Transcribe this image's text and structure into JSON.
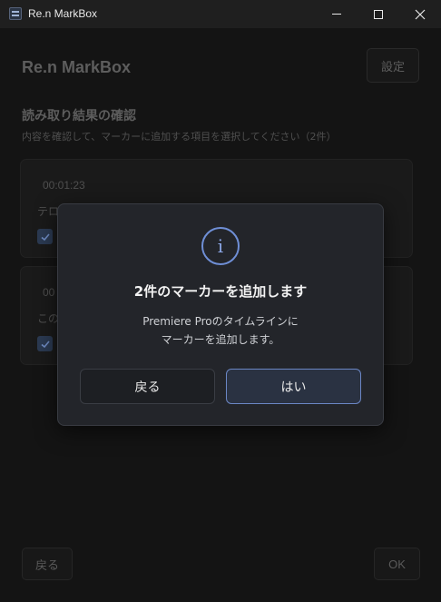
{
  "window": {
    "title": "Re.n MarkBox",
    "minimize": "—",
    "maximize": "☐",
    "close": "✕"
  },
  "app": {
    "title": "Re.n MarkBox",
    "settings_label": "設定"
  },
  "section": {
    "title": "読み取り結果の確認",
    "subtitle": "内容を確認して、マーカーに追加する項目を選択してください（2件）"
  },
  "cards": [
    {
      "time": "00:01:23",
      "text": "テロ",
      "checked": true
    },
    {
      "time": "00",
      "text": "この",
      "checked": true
    }
  ],
  "footer": {
    "back_label": "戻る",
    "ok_label": "OK"
  },
  "modal": {
    "icon": "info-icon",
    "icon_glyph": "i",
    "title": "2件のマーカーを追加します",
    "message_line1": "Premiere Proのタイムラインに",
    "message_line2": "マーカーを追加します。",
    "back_label": "戻る",
    "yes_label": "はい"
  }
}
